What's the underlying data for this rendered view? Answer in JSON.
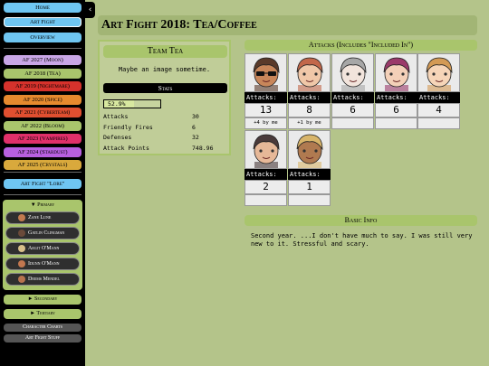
{
  "sidebar": {
    "home": "Home",
    "art_fight": "Art Fight",
    "overview": "Overview",
    "years": [
      {
        "label": "AF 2027 (Moon)",
        "color": "#c9a6e6"
      },
      {
        "label": "AF 2018 (Tea)",
        "color": "#a9c56c"
      },
      {
        "label": "AF 2019 (Nightmare)",
        "color": "#d6322c"
      },
      {
        "label": "AF 2020 (Spice)",
        "color": "#e68a2e"
      },
      {
        "label": "AF 2021 (Cyberteam)",
        "color": "#e04f30"
      },
      {
        "label": "AF 2022 (Bloom)",
        "color": "#a9c56c"
      },
      {
        "label": "AF 2023 (Vampires)",
        "color": "#e0306a"
      },
      {
        "label": "AF 2024 (Stardust)",
        "color": "#b860e0"
      },
      {
        "label": "AF 2025 (Crystals)",
        "color": "#d9a93c"
      }
    ],
    "lore": "Art Fight \"Lore\"",
    "primary_label": "▼ Primary",
    "primary_chars": [
      {
        "name": "Zane Lune",
        "color": "#c27a4f"
      },
      {
        "name": "Gatlin Clingman",
        "color": "#6b4a3a"
      },
      {
        "name": "Aegit O'Mann",
        "color": "#d8c08a"
      },
      {
        "name": "Idunn O'Mann",
        "color": "#c2774f"
      },
      {
        "name": "Deems Mendel",
        "color": "#b8734e"
      }
    ],
    "secondary_label": "► Secondary",
    "tertiary_label": "► Tertiary",
    "character_charts": "Character Charts",
    "art_fight_stuff": "Art Fight Stuff"
  },
  "page": {
    "title": "Art Fight 2018: Tea/Coffee"
  },
  "team": {
    "title": "Team Tea",
    "note": "Maybe an image sometime.",
    "stats_label": "Stats",
    "progress_text": "52.9%",
    "progress_value": 0.529,
    "stats": [
      {
        "label": "Attacks",
        "value": "30"
      },
      {
        "label": "Friendly Fires",
        "value": "6"
      },
      {
        "label": "Defenses",
        "value": "32"
      },
      {
        "label": "Attack Points",
        "value": "748.96"
      }
    ]
  },
  "attacks": {
    "header": "Attacks (Includes \"Included In\")",
    "cards": [
      {
        "label": "Attacks:",
        "count": "13",
        "note": "+4 by me",
        "hair": "#5a3a2a",
        "skin": "#c8865a",
        "accessory": "sunglasses"
      },
      {
        "label": "Attacks:",
        "count": "8",
        "note": "+1 by me",
        "hair": "#c2674a",
        "skin": "#f0c7a8",
        "accessory": "none"
      },
      {
        "label": "Attacks:",
        "count": "6",
        "note": "",
        "hair": "#a7a7a7",
        "skin": "#f2e4dc",
        "accessory": "none"
      },
      {
        "label": "Attacks:",
        "count": "6",
        "note": "",
        "hair": "#9a3a6a",
        "skin": "#f3d0b8",
        "accessory": "none"
      },
      {
        "label": "Attacks:",
        "count": "4",
        "note": "",
        "hair": "#d39a55",
        "skin": "#f6d5b8",
        "accessory": "none"
      },
      {
        "label": "Attacks:",
        "count": "2",
        "note": "",
        "hair": "#4a3a3a",
        "skin": "#e6b898",
        "accessory": "none"
      },
      {
        "label": "Attacks:",
        "count": "1",
        "note": "",
        "hair": "#d8b56a",
        "skin": "#b07a50",
        "accessory": "none"
      }
    ]
  },
  "basic_info": {
    "header": "Basic Info",
    "text": "Second year. ...I don't have much to say. I was still very new to it. Stressful and scary."
  },
  "icons": {
    "collapse": "chevron-left-icon",
    "lore": "book-icon"
  }
}
